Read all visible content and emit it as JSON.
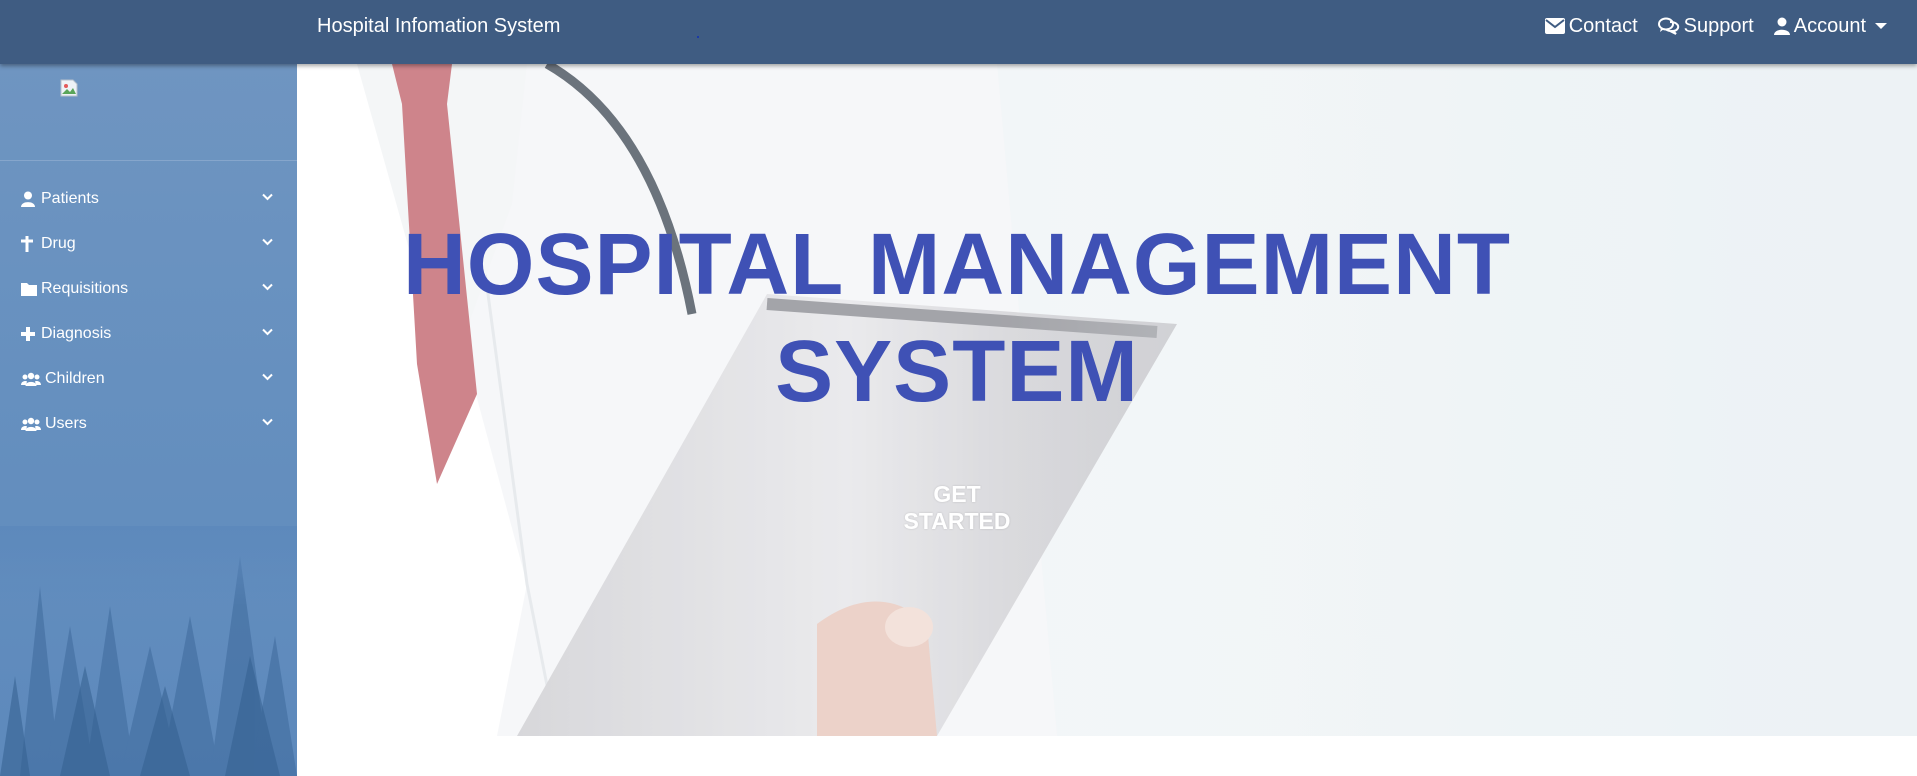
{
  "navbar": {
    "brand": "Hospital Infomation System",
    "links": [
      {
        "label": "Contact",
        "icon": "envelope-icon"
      },
      {
        "label": "Support",
        "icon": "comments-icon"
      },
      {
        "label": "Account",
        "icon": "user-icon"
      }
    ]
  },
  "sidebar": {
    "logo_alt": "",
    "items": [
      {
        "label": "Patients",
        "icon": "user-icon"
      },
      {
        "label": "Drug",
        "icon": "cross-icon"
      },
      {
        "label": "Requisitions",
        "icon": "folder-icon"
      },
      {
        "label": "Diagnosis",
        "icon": "plus-icon"
      },
      {
        "label": "Children",
        "icon": "users-icon"
      },
      {
        "label": "Users",
        "icon": "users-icon"
      }
    ]
  },
  "hero": {
    "title_line1": "HOSPITAL MANAGEMENT",
    "title_line2": "SYSTEM",
    "cta_label": "GET STARTED"
  },
  "colors": {
    "navbar_bg": "#3f5c82",
    "sidebar_bg": "#6690bf",
    "title": "#3f51b5",
    "cta_text": "#ffffff"
  }
}
